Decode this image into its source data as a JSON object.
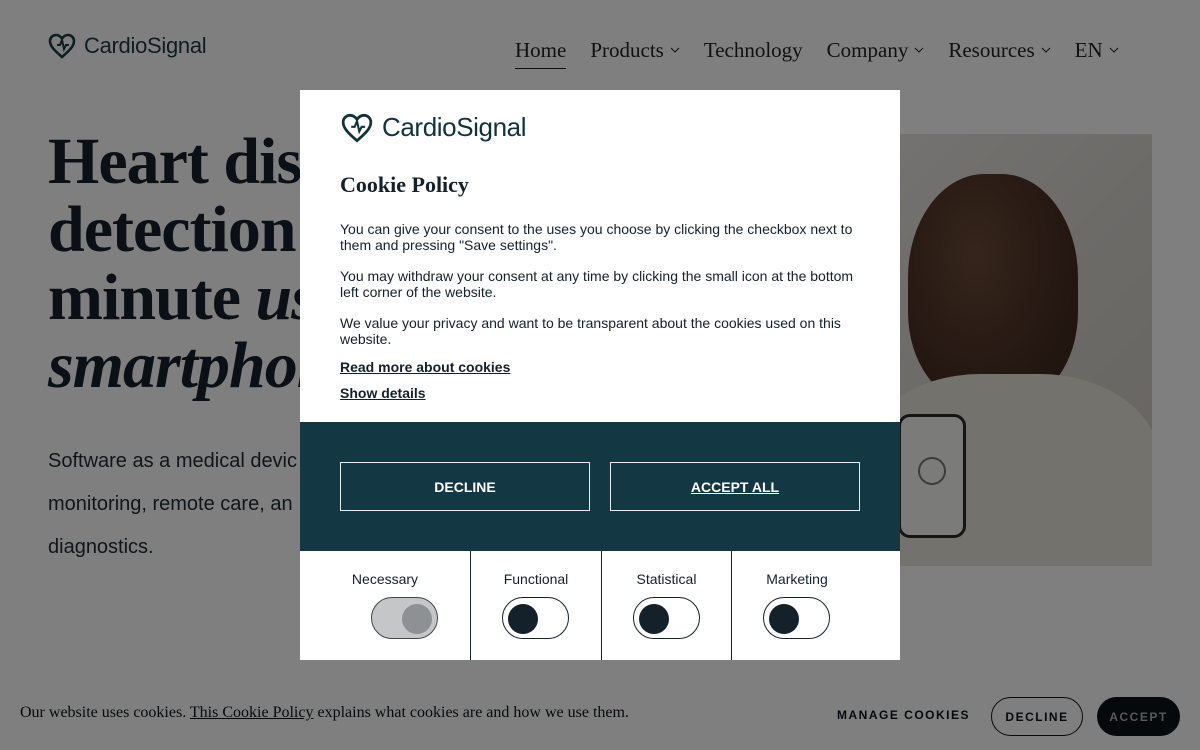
{
  "site": {
    "logo_text": "CardioSignal",
    "nav": [
      {
        "label": "Home",
        "dropdown": false,
        "active": true
      },
      {
        "label": "Products",
        "dropdown": true
      },
      {
        "label": "Technology",
        "dropdown": false
      },
      {
        "label": "Company",
        "dropdown": true
      },
      {
        "label": "Resources",
        "dropdown": true
      },
      {
        "label": "EN",
        "dropdown": true
      }
    ],
    "hero": {
      "line1": "Heart dise",
      "line2": "detection i",
      "line3_plain": "minute ",
      "line3_italic": "us",
      "line4_italic": "smartphon",
      "sub_line1": "Software as a medical devic",
      "sub_line2": "monitoring, remote care, an",
      "sub_line3": "diagnostics."
    }
  },
  "modal": {
    "logo_text": "CardioSignal",
    "title": "Cookie Policy",
    "paragraphs": [
      "You can give your consent to the uses you choose by clicking the checkbox next to them and pressing \"Save settings\".",
      "You may withdraw your consent at any time by clicking the small icon at the bottom left corner of the website.",
      "We value your privacy and want to be transparent about the cookies used on this website."
    ],
    "read_more": "Read more about cookies",
    "show_details": "Show details",
    "decline": "DECLINE",
    "accept_all": "ACCEPT ALL",
    "categories": [
      {
        "label": "Necessary",
        "enabled": true,
        "locked": true
      },
      {
        "label": "Functional",
        "enabled": false
      },
      {
        "label": "Statistical",
        "enabled": false
      },
      {
        "label": "Marketing",
        "enabled": false
      }
    ]
  },
  "cookie_bar": {
    "text_before": "Our website uses cookies. ",
    "link": "This Cookie Policy",
    "text_after": " explains what cookies are and how we use them.",
    "manage": "MANAGE COOKIES",
    "decline": "DECLINE",
    "accept": "ACCEPT"
  },
  "colors": {
    "brand_dark": "#143843",
    "overlay": "rgba(0,0,0,0.5)",
    "text_dark": "#14202a"
  },
  "icons": {
    "logo": "heart-signal-icon",
    "dropdown": "chevron-down-icon"
  }
}
